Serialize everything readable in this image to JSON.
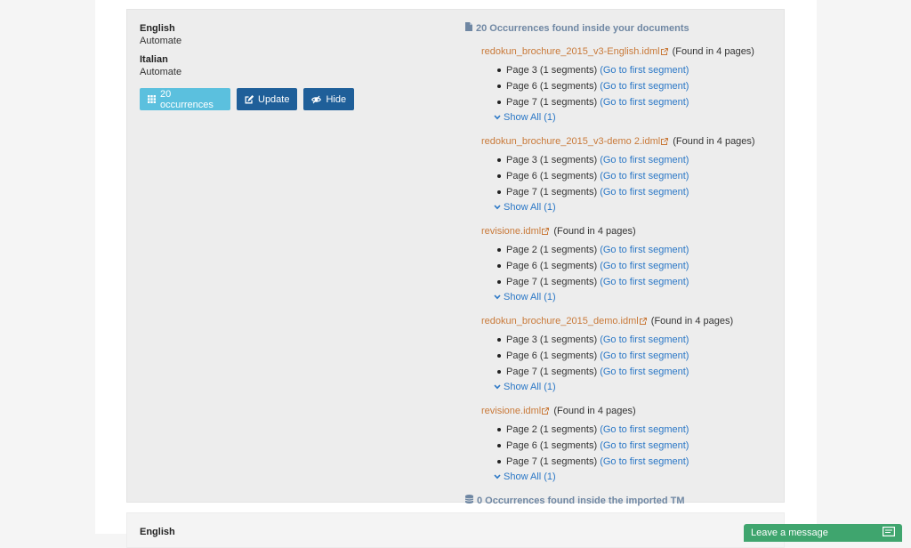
{
  "source": {
    "label": "English",
    "value": "Automate"
  },
  "target": {
    "label": "Italian",
    "value": "Automate"
  },
  "buttons": {
    "occurrences": "20 occurrences",
    "update": "Update",
    "hide": "Hide"
  },
  "results": {
    "heading": "20 Occurrences found inside your documents",
    "documents": [
      {
        "name": "redokun_brochure_2015_v3-English.idml",
        "found": "(Found in 4 pages)",
        "pages": [
          {
            "label": "Page 3 (1 segments)",
            "link": "(Go to first segment)"
          },
          {
            "label": "Page 6 (1 segments)",
            "link": "(Go to first segment)"
          },
          {
            "label": "Page 7 (1 segments)",
            "link": "(Go to first segment)"
          }
        ],
        "show_all": "Show All (1)"
      },
      {
        "name": "redokun_brochure_2015_v3-demo 2.idml",
        "found": "(Found in 4 pages)",
        "pages": [
          {
            "label": "Page 3 (1 segments)",
            "link": "(Go to first segment)"
          },
          {
            "label": "Page 6 (1 segments)",
            "link": "(Go to first segment)"
          },
          {
            "label": "Page 7 (1 segments)",
            "link": "(Go to first segment)"
          }
        ],
        "show_all": "Show All (1)"
      },
      {
        "name": "revisione.idml",
        "found": "(Found in 4 pages)",
        "pages": [
          {
            "label": "Page 2 (1 segments)",
            "link": "(Go to first segment)"
          },
          {
            "label": "Page 6 (1 segments)",
            "link": "(Go to first segment)"
          },
          {
            "label": "Page 7 (1 segments)",
            "link": "(Go to first segment)"
          }
        ],
        "show_all": "Show All (1)"
      },
      {
        "name": "redokun_brochure_2015_demo.idml",
        "found": "(Found in 4 pages)",
        "pages": [
          {
            "label": "Page 3 (1 segments)",
            "link": "(Go to first segment)"
          },
          {
            "label": "Page 6 (1 segments)",
            "link": "(Go to first segment)"
          },
          {
            "label": "Page 7 (1 segments)",
            "link": "(Go to first segment)"
          }
        ],
        "show_all": "Show All (1)"
      },
      {
        "name": "revisione.idml",
        "found": "(Found in 4 pages)",
        "pages": [
          {
            "label": "Page 2 (1 segments)",
            "link": "(Go to first segment)"
          },
          {
            "label": "Page 6 (1 segments)",
            "link": "(Go to first segment)"
          },
          {
            "label": "Page 7 (1 segments)",
            "link": "(Go to first segment)"
          }
        ],
        "show_all": "Show All (1)"
      }
    ],
    "tm_heading": "0 Occurrences found inside the imported TM"
  },
  "next_entry": {
    "label": "English"
  },
  "chat": {
    "label": "Leave a message"
  },
  "icons": {
    "occurrences": "grid-icon",
    "update": "edit-icon",
    "hide": "eye-slash-icon",
    "documents": "file-icon",
    "tm": "database-icon",
    "external": "external-link-icon",
    "show_all": "chevron-down-icon",
    "chat": "chat-icon"
  },
  "colors": {
    "btn_info": "#5bc0de",
    "btn_primary": "#1f5f99",
    "doc_link": "#c97a3a",
    "segment_link": "#2a77c6",
    "heading": "#6f87a3",
    "chat": "#3fa56e"
  }
}
